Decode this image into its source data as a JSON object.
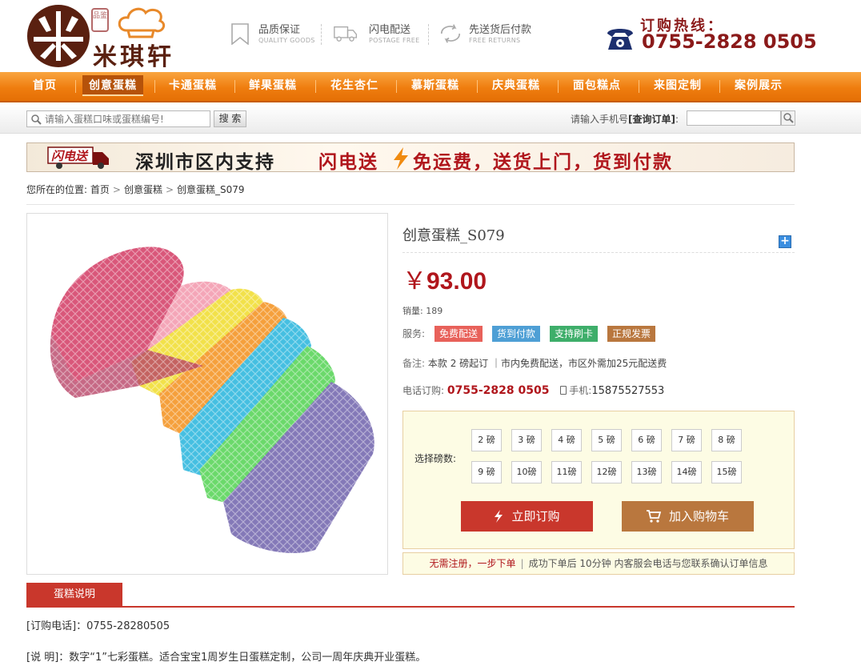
{
  "header": {
    "logo": {
      "seal_text": "品鉴",
      "brand_text": "米琪轩",
      "icon": "chef-hat-icon"
    },
    "features": [
      {
        "title": "品质保证",
        "subtitle": "QUALITY GOODS",
        "icon": "bookmark-icon"
      },
      {
        "title": "闪电配送",
        "subtitle": "POSTAGE FREE",
        "icon": "truck-icon"
      },
      {
        "title": "先送货后付款",
        "subtitle": "FREE RETURNS",
        "icon": "return-arrows-icon"
      }
    ],
    "hotline": {
      "title": "订购热线：",
      "number": "0755-2828 0505",
      "icon": "telephone-icon"
    }
  },
  "nav": {
    "items": [
      {
        "label": "首页",
        "active": false
      },
      {
        "label": "创意蛋糕",
        "active": true
      },
      {
        "label": "卡通蛋糕",
        "active": false
      },
      {
        "label": "鲜果蛋糕",
        "active": false
      },
      {
        "label": "花生杏仁",
        "active": false
      },
      {
        "label": "慕斯蛋糕",
        "active": false
      },
      {
        "label": "庆典蛋糕",
        "active": false
      },
      {
        "label": "面包糕点",
        "active": false
      },
      {
        "label": "来图定制",
        "active": false
      },
      {
        "label": "案例展示",
        "active": false
      }
    ],
    "colors": {
      "bar": "#ef7d0f",
      "active": "#b5520a"
    }
  },
  "searchbar": {
    "search_placeholder": "请输入蛋糕口味或蛋糕编号!",
    "search_button": "搜 索",
    "order_query_prefix": "请输入手机号",
    "order_query_label": "[查询订单]",
    "order_query_suffix": ":"
  },
  "banner": {
    "badge": "闪电送",
    "text_black": "深圳市区内支持",
    "text_red": "闪电送",
    "text_red2": "免运费，送货上门，货到付款"
  },
  "breadcrumb": {
    "prefix": "您所在的位置:",
    "items": [
      "首页",
      "创意蛋糕",
      "创意蛋糕_S079"
    ],
    "separator": ">"
  },
  "product": {
    "title": "创意蛋糕_S079",
    "currency": "￥",
    "price": "93.00",
    "sales_label": "销量:",
    "sales_value": "189",
    "service_label": "服务:",
    "service_tags": [
      {
        "label": "免费配送",
        "color": "#e8615a"
      },
      {
        "label": "货到付款",
        "color": "#4e9fd5"
      },
      {
        "label": "支持刷卡",
        "color": "#3eae6a"
      },
      {
        "label": "正规发票",
        "color": "#b9773e"
      }
    ],
    "note_label": "备注:",
    "note_text": "本款 2 磅起订 ｜市内免费配送，市区外需加25元配送费",
    "phone_label": "电话订购:",
    "phone_value": "0755-2828 0505",
    "mobile_label": "手机:",
    "mobile_value": "15875527553",
    "size_label": "选择磅数:",
    "sizes": [
      "2 磅",
      "3 磅",
      "4 磅",
      "5 磅",
      "6 磅",
      "7 磅",
      "8 磅",
      "9 磅",
      "10磅",
      "11磅",
      "12磅",
      "13磅",
      "14磅",
      "15磅"
    ],
    "buy_button": "立即订购",
    "cart_button": "加入购物车",
    "notice_red": "无需注册，一步下单",
    "notice_text": "成功下单后 10分钟 内客服会电话与您联系确认订单信息",
    "colors": {
      "price": "#b0161c",
      "buy": "#c9372c",
      "cart": "#b9773e"
    }
  },
  "description": {
    "tab_label": "蛋糕说明",
    "order_phone_line": "[订购电话]：0755-28280505",
    "desc_line": "[说 明]：数字“1”七彩蛋糕。适合宝宝1周岁生日蛋糕定制，公司一周年庆典开业蛋糕。"
  }
}
